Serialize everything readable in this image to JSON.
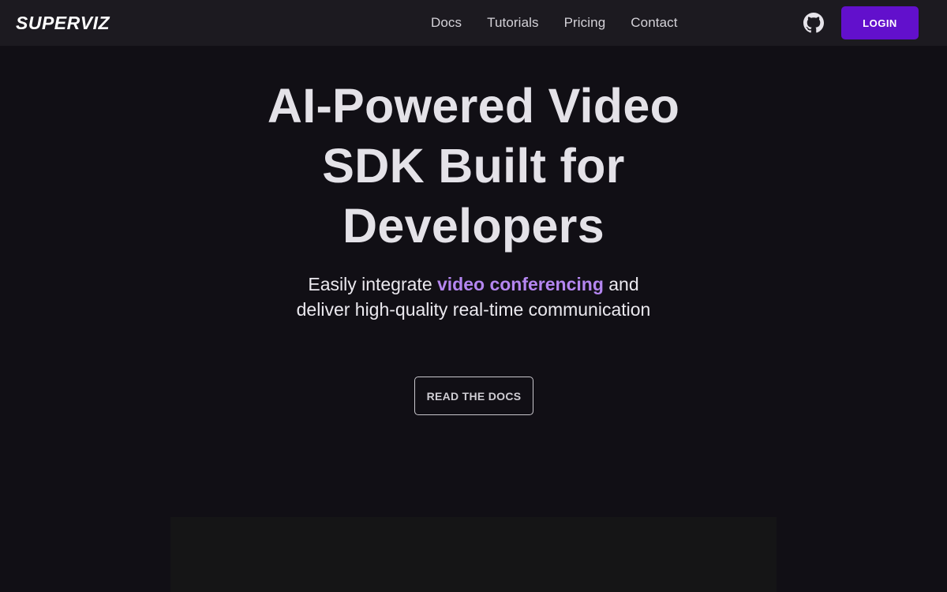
{
  "brand": {
    "logo_text": "SUPERVIZ"
  },
  "nav": {
    "links": [
      {
        "label": "Docs"
      },
      {
        "label": "Tutorials"
      },
      {
        "label": "Pricing"
      },
      {
        "label": "Contact"
      }
    ],
    "github_icon": "github-icon",
    "login_label": "LOGIN"
  },
  "hero": {
    "title_lines": [
      "AI-Powered Video",
      "SDK Built for",
      "Developers"
    ],
    "subtitle_before": "Easily integrate ",
    "subtitle_highlight": "video conferencing",
    "subtitle_after": " and deliver high-quality real-time communication",
    "cta_label": "READ THE DOCS"
  },
  "colors": {
    "background": "#110f15",
    "navbar": "#1c1a20",
    "accent": "#6210cc",
    "highlight": "#b486f0",
    "video_placeholder": "#151516"
  }
}
